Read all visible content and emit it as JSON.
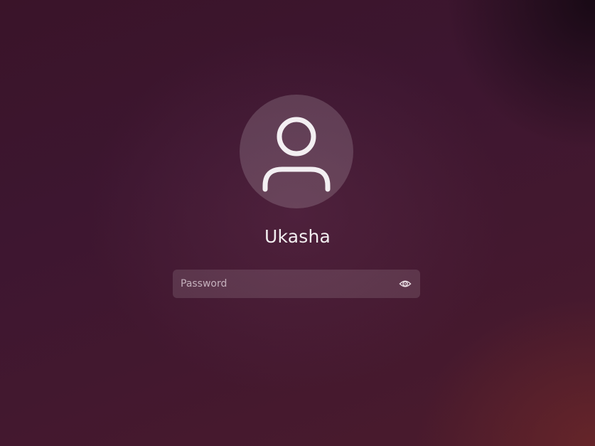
{
  "user": {
    "name": "Ukasha",
    "avatar_icon": "user-silhouette-icon"
  },
  "password": {
    "placeholder": "Password",
    "value": "",
    "reveal_icon": "eye-icon"
  },
  "colors": {
    "background": "#3d1630",
    "text": "#f2eef0",
    "field_background": "rgba(255,255,255,0.12)"
  }
}
